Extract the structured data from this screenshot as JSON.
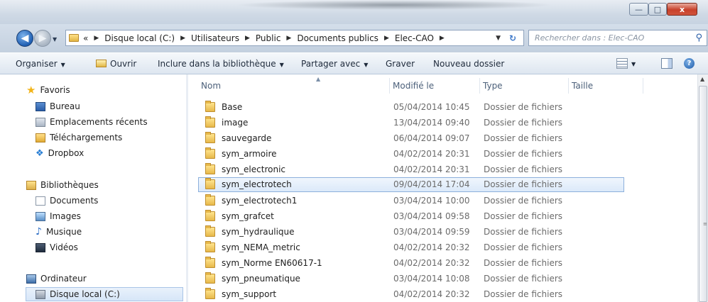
{
  "window": {
    "controls": {
      "minimize": "—",
      "maximize": "□",
      "close": "x"
    }
  },
  "address": {
    "breadcrumbs": [
      {
        "label": "«"
      },
      {
        "label": "Disque local (C:)"
      },
      {
        "label": "Utilisateurs"
      },
      {
        "label": "Public"
      },
      {
        "label": "Documents publics"
      },
      {
        "label": "Elec-CAO"
      }
    ],
    "separator": "▶",
    "search_placeholder": "Rechercher dans : Elec-CAO"
  },
  "toolbar": {
    "organize": "Organiser",
    "open": "Ouvrir",
    "include": "Inclure dans la bibliothèque",
    "share": "Partager avec",
    "burn": "Graver",
    "new_folder": "Nouveau dossier",
    "dropdown_arrow": "▼"
  },
  "nav": {
    "favorites": "Favoris",
    "desktop": "Bureau",
    "recent": "Emplacements récents",
    "downloads": "Téléchargements",
    "dropbox": "Dropbox",
    "libraries": "Bibliothèques",
    "documents": "Documents",
    "images": "Images",
    "music": "Musique",
    "videos": "Vidéos",
    "computer": "Ordinateur",
    "local_disk": "Disque local (C:)"
  },
  "columns": {
    "name": "Nom",
    "modified": "Modifié le",
    "type": "Type",
    "size": "Taille"
  },
  "files": [
    {
      "name": "Base",
      "modified": "05/04/2014 10:45",
      "type": "Dossier de fichiers"
    },
    {
      "name": "image",
      "modified": "13/04/2014 09:40",
      "type": "Dossier de fichiers"
    },
    {
      "name": "sauvegarde",
      "modified": "06/04/2014 09:07",
      "type": "Dossier de fichiers"
    },
    {
      "name": "sym_armoire",
      "modified": "04/02/2014 20:31",
      "type": "Dossier de fichiers"
    },
    {
      "name": "sym_electronic",
      "modified": "04/02/2014 20:31",
      "type": "Dossier de fichiers"
    },
    {
      "name": "sym_electrotech",
      "modified": "09/04/2014 17:04",
      "type": "Dossier de fichiers",
      "selected": true
    },
    {
      "name": "sym_electrotech1",
      "modified": "03/04/2014 10:00",
      "type": "Dossier de fichiers"
    },
    {
      "name": "sym_grafcet",
      "modified": "03/04/2014 09:58",
      "type": "Dossier de fichiers"
    },
    {
      "name": "sym_hydraulique",
      "modified": "03/04/2014 09:59",
      "type": "Dossier de fichiers"
    },
    {
      "name": "sym_NEMA_metric",
      "modified": "04/02/2014 20:32",
      "type": "Dossier de fichiers"
    },
    {
      "name": "sym_Norme EN60617-1",
      "modified": "04/02/2014 20:32",
      "type": "Dossier de fichiers"
    },
    {
      "name": "sym_pneumatique",
      "modified": "03/04/2014 10:08",
      "type": "Dossier de fichiers"
    },
    {
      "name": "sym_support",
      "modified": "04/02/2014 20:32",
      "type": "Dossier de fichiers"
    }
  ],
  "colors": {
    "selection_border": "#8db0dc",
    "selection_fill": "#dbe9f9",
    "close_button": "#c7412b"
  }
}
